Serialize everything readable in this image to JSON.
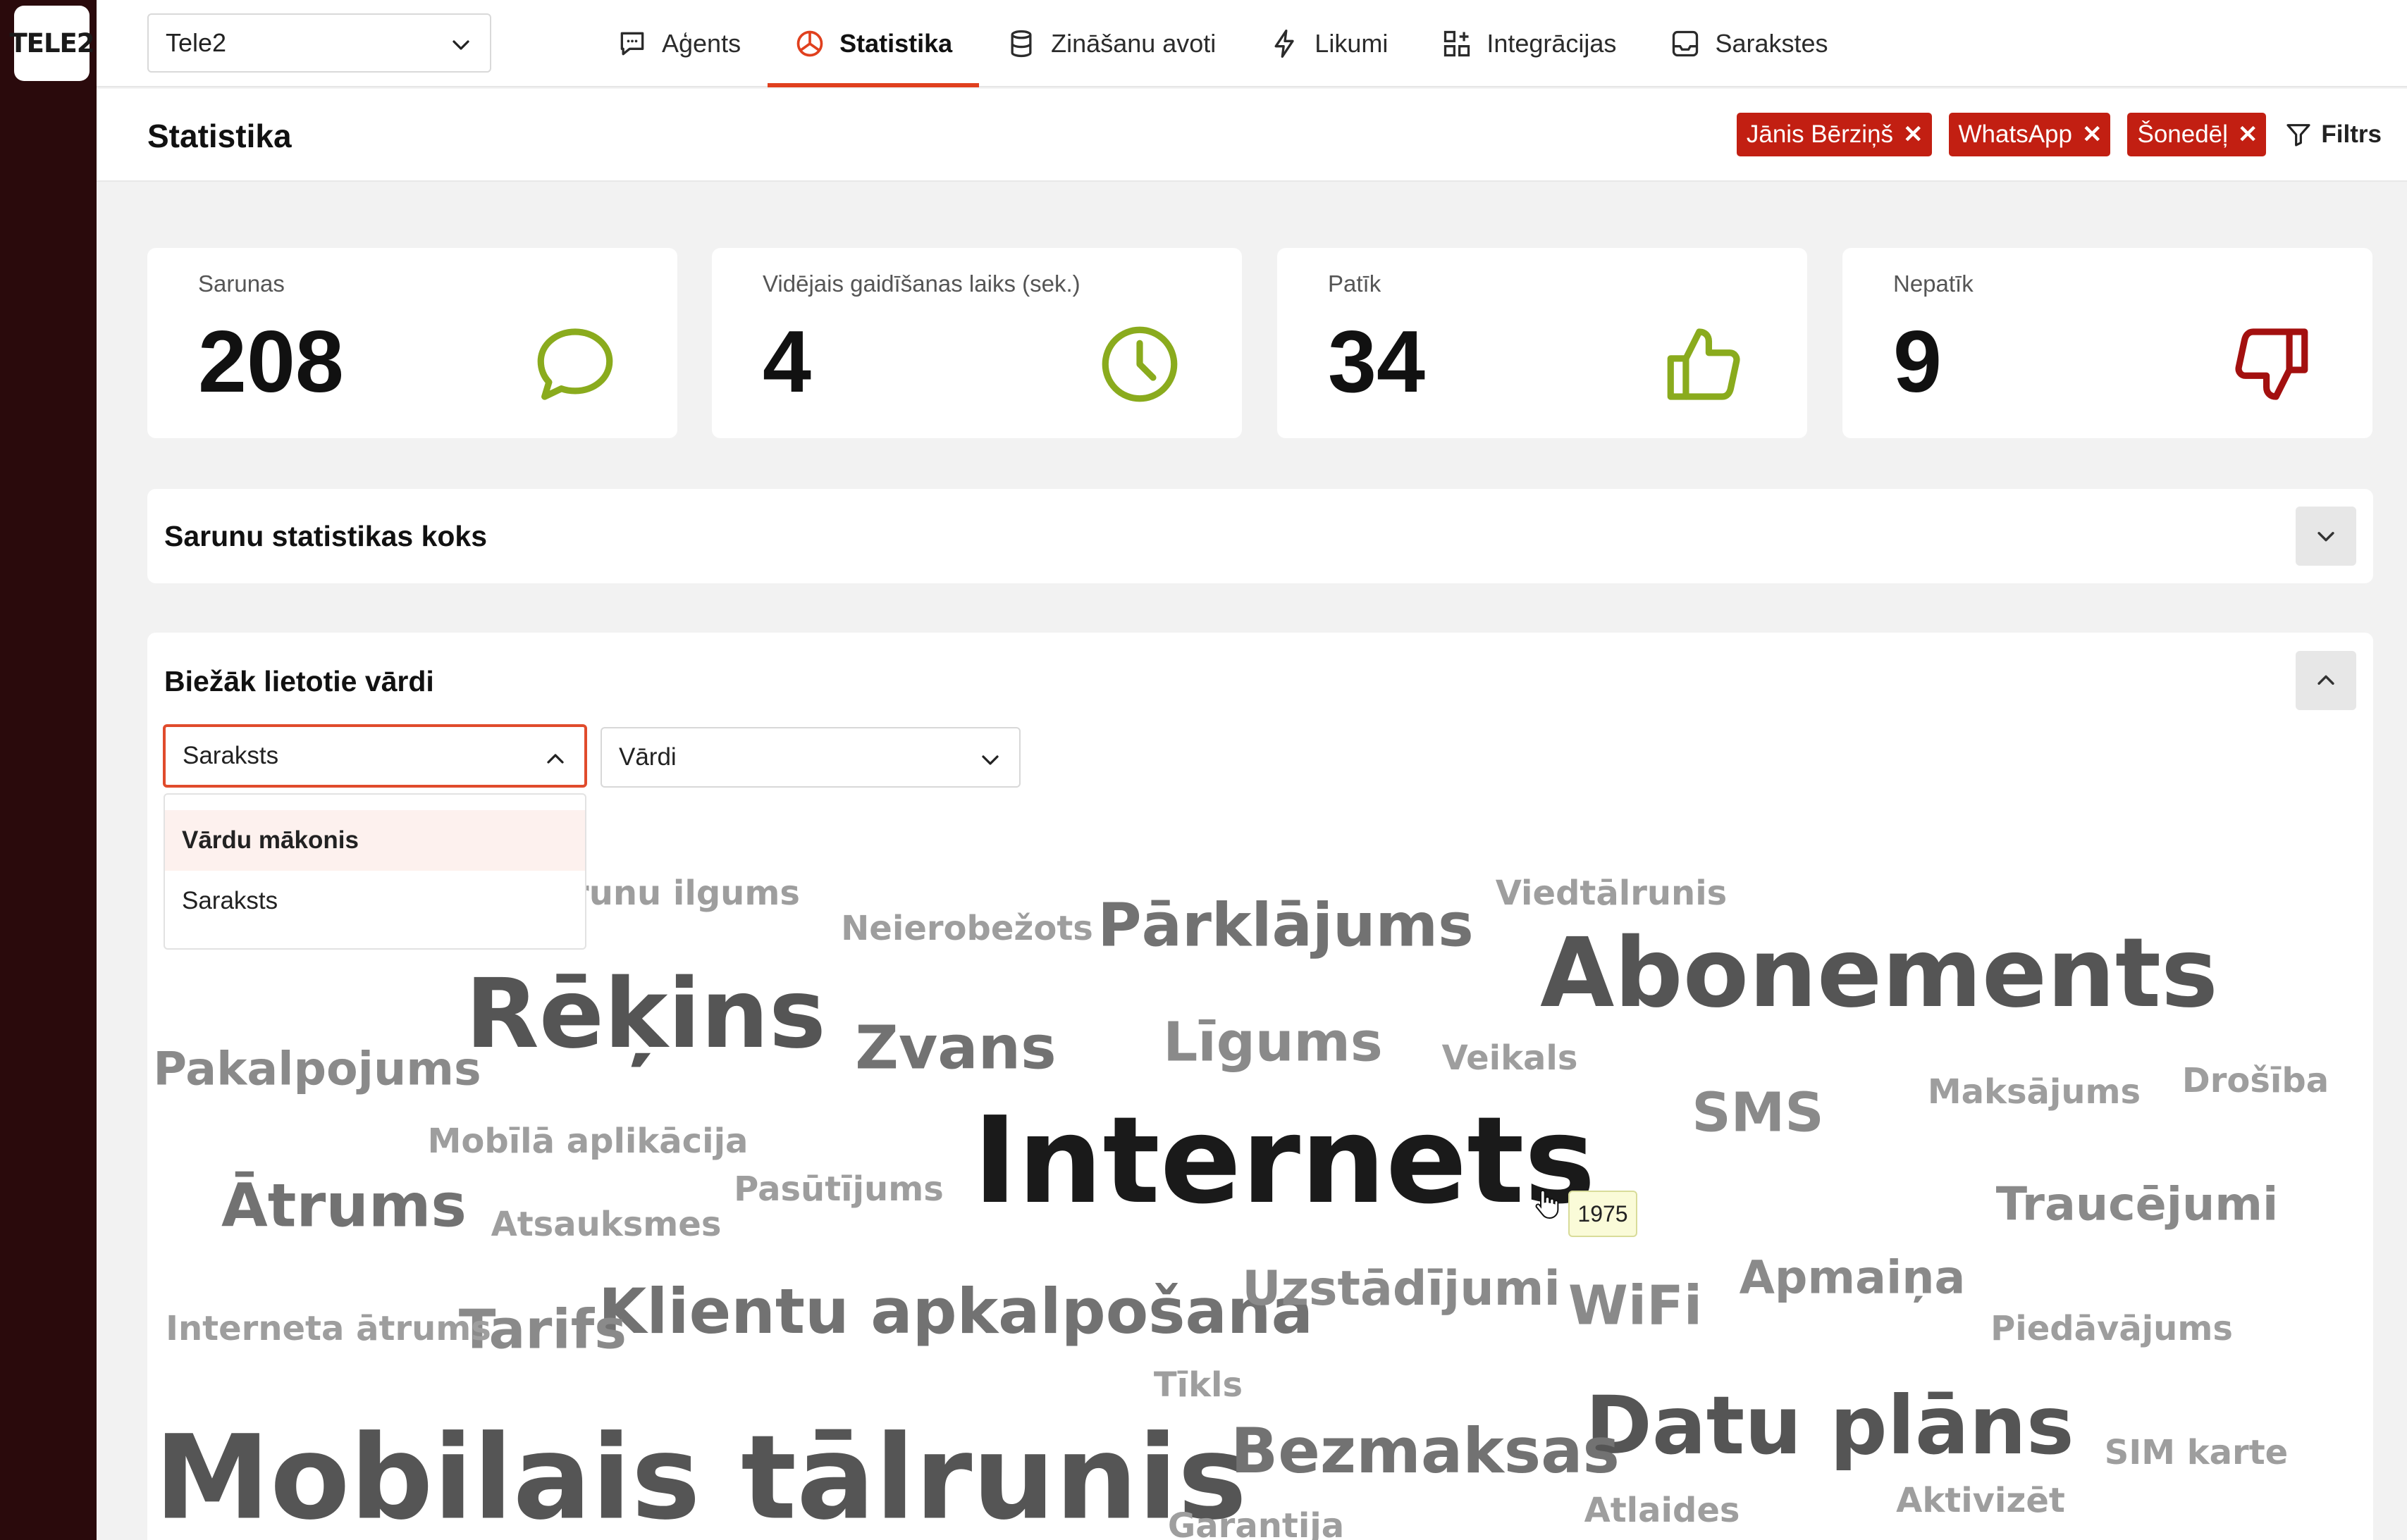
{
  "brand": {
    "logo_text": "TELE2",
    "accent": "#e0401e",
    "chip_color": "#c21f12",
    "rail_color": "#2a0a0c"
  },
  "header": {
    "tenant": "Tele2",
    "nav": [
      {
        "label": "Aģents",
        "icon": "chat-square-icon",
        "active": false
      },
      {
        "label": "Statistika",
        "icon": "pie-chart-icon",
        "active": true
      },
      {
        "label": "Zināšanu avoti",
        "icon": "database-icon",
        "active": false
      },
      {
        "label": "Likumi",
        "icon": "lightning-icon",
        "active": false
      },
      {
        "label": "Integrācijas",
        "icon": "grid-plus-icon",
        "active": false
      },
      {
        "label": "Sarakstes",
        "icon": "inbox-icon",
        "active": false
      }
    ]
  },
  "page": {
    "title": "Statistika",
    "filters": [
      "Jānis Bērziņš",
      "WhatsApp",
      "Šonedēļ"
    ],
    "filter_button": "Filtrs"
  },
  "stats": [
    {
      "label": "Sarunas",
      "value": "208",
      "icon": "speech-bubble-icon",
      "color": "#8aab1d"
    },
    {
      "label": "Vidējais gaidīšanas laiks (sek.)",
      "value": "4",
      "icon": "clock-icon",
      "color": "#8aab1d"
    },
    {
      "label": "Patīk",
      "value": "34",
      "icon": "thumbs-up-icon",
      "color": "#8aab1d"
    },
    {
      "label": "Nepatīk",
      "value": "9",
      "icon": "thumbs-down-icon",
      "color": "#a3100f"
    }
  ],
  "tree_panel": {
    "title": "Sarunu statistikas koks"
  },
  "words_panel": {
    "title": "Biežāk lietotie vārdi",
    "view_select": "Saraksts",
    "type_select": "Vārdi",
    "view_options": [
      "Vārdu mākonis",
      "Saraksts"
    ],
    "highlighted_option": "Vārdu mākonis",
    "tooltip": "1975"
  },
  "words": [
    {
      "text": "Internets",
      "size": 1.0,
      "color": "#1a1a1a"
    },
    {
      "text": "Mobilais tālrunis",
      "size": 0.97,
      "color": "#555555"
    },
    {
      "text": "Abonements",
      "size": 0.8,
      "color": "#555555"
    },
    {
      "text": "Rēķins",
      "size": 0.8,
      "color": "#555555"
    },
    {
      "text": "Datu plāns",
      "size": 0.67,
      "color": "#555555"
    },
    {
      "text": "Klientu apkalpošana",
      "size": 0.52,
      "color": "#727272"
    },
    {
      "text": "Bezmaksas",
      "size": 0.52,
      "color": "#727272"
    },
    {
      "text": "Pārklājums",
      "size": 0.5,
      "color": "#727272"
    },
    {
      "text": "Zvans",
      "size": 0.5,
      "color": "#727272"
    },
    {
      "text": "Ātrums",
      "size": 0.5,
      "color": "#727272"
    },
    {
      "text": "Līgums",
      "size": 0.45,
      "color": "#8a8a8a"
    },
    {
      "text": "SMS",
      "size": 0.45,
      "color": "#8a8a8a"
    },
    {
      "text": "Tarifs",
      "size": 0.45,
      "color": "#8a8a8a"
    },
    {
      "text": "WiFi",
      "size": 0.45,
      "color": "#8a8a8a"
    },
    {
      "text": "Uzstādījumi",
      "size": 0.4,
      "color": "#8a8a8a"
    },
    {
      "text": "Apmaiņa",
      "size": 0.38,
      "color": "#8a8a8a"
    },
    {
      "text": "Traucējumi",
      "size": 0.38,
      "color": "#8a8a8a"
    },
    {
      "text": "Pakalpojums",
      "size": 0.38,
      "color": "#8a8a8a"
    },
    {
      "text": "Maksājums",
      "size": 0.28,
      "color": "#9e9e9e"
    },
    {
      "text": "Drošība",
      "size": 0.28,
      "color": "#9e9e9e"
    },
    {
      "text": "Piedāvājums",
      "size": 0.28,
      "color": "#9e9e9e"
    },
    {
      "text": "Interneta ātrums",
      "size": 0.28,
      "color": "#9e9e9e"
    },
    {
      "text": "Mobīlā aplikācija",
      "size": 0.28,
      "color": "#9e9e9e"
    },
    {
      "text": "Pasūtījums",
      "size": 0.28,
      "color": "#9e9e9e"
    },
    {
      "text": "Atsauksmes",
      "size": 0.28,
      "color": "#9e9e9e"
    },
    {
      "text": "Sarunu ilgums",
      "size": 0.28,
      "color": "#9e9e9e"
    },
    {
      "text": "Neierobežots",
      "size": 0.28,
      "color": "#9e9e9e"
    },
    {
      "text": "Viedtālrunis",
      "size": 0.28,
      "color": "#9e9e9e"
    },
    {
      "text": "Veikals",
      "size": 0.28,
      "color": "#9e9e9e"
    },
    {
      "text": "Tīkls",
      "size": 0.28,
      "color": "#9e9e9e"
    },
    {
      "text": "SIM karte",
      "size": 0.28,
      "color": "#9e9e9e"
    },
    {
      "text": "Atlaides",
      "size": 0.28,
      "color": "#9e9e9e"
    },
    {
      "text": "Aktivizēt",
      "size": 0.28,
      "color": "#9e9e9e"
    },
    {
      "text": "Garantija",
      "size": 0.28,
      "color": "#9e9e9e"
    }
  ]
}
